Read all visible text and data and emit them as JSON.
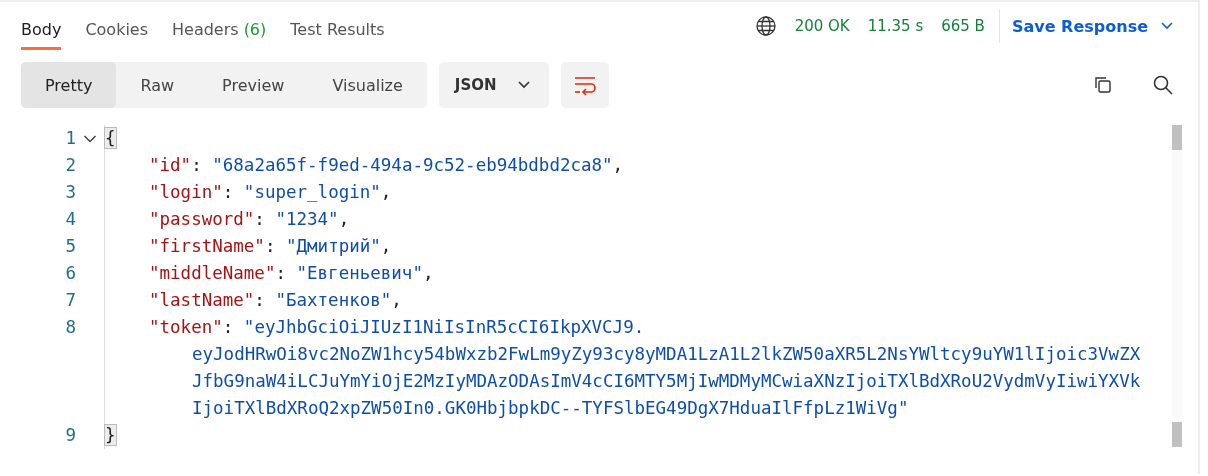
{
  "tabs": [
    {
      "label": "Body",
      "selected": true
    },
    {
      "label": "Cookies",
      "selected": false
    },
    {
      "label": "Headers",
      "count": "(6)",
      "selected": false
    },
    {
      "label": "Test Results",
      "selected": false
    }
  ],
  "status": {
    "code": "200 OK",
    "time": "11.35 s",
    "size": "665 B"
  },
  "save_response": "Save Response",
  "views": [
    {
      "label": "Pretty",
      "selected": true
    },
    {
      "label": "Raw",
      "selected": false
    },
    {
      "label": "Preview",
      "selected": false
    },
    {
      "label": "Visualize",
      "selected": false
    }
  ],
  "format": "JSON",
  "wrap_lines": {
    "on": true
  },
  "lines": [
    {
      "number": "1",
      "kind": "brace",
      "fold": true,
      "tokens": [
        {
          "t": "{",
          "kind": "brace",
          "highlighted": true
        }
      ]
    },
    {
      "number": "2",
      "kind": "member",
      "tokens": [
        {
          "t": "\"id\"",
          "kind": "key"
        },
        {
          "t": ": ",
          "kind": "punct"
        },
        {
          "t": "\"68a2a65f-f9ed-494a-9c52-eb94bdbd2ca8\"",
          "kind": "string"
        },
        {
          "t": ",",
          "kind": "punct"
        }
      ]
    },
    {
      "number": "3",
      "kind": "member",
      "tokens": [
        {
          "t": "\"login\"",
          "kind": "key"
        },
        {
          "t": ": ",
          "kind": "punct"
        },
        {
          "t": "\"super_login\"",
          "kind": "string"
        },
        {
          "t": ",",
          "kind": "punct"
        }
      ]
    },
    {
      "number": "4",
      "kind": "member",
      "tokens": [
        {
          "t": "\"password\"",
          "kind": "key"
        },
        {
          "t": ": ",
          "kind": "punct"
        },
        {
          "t": "\"1234\"",
          "kind": "string"
        },
        {
          "t": ",",
          "kind": "punct"
        }
      ]
    },
    {
      "number": "5",
      "kind": "member",
      "tokens": [
        {
          "t": "\"firstName\"",
          "kind": "key"
        },
        {
          "t": ": ",
          "kind": "punct"
        },
        {
          "t": "\"Дмитрий\"",
          "kind": "string"
        },
        {
          "t": ",",
          "kind": "punct"
        }
      ]
    },
    {
      "number": "6",
      "kind": "member",
      "tokens": [
        {
          "t": "\"middleName\"",
          "kind": "key"
        },
        {
          "t": ": ",
          "kind": "punct"
        },
        {
          "t": "\"Евгеньевич\"",
          "kind": "string"
        },
        {
          "t": ",",
          "kind": "punct"
        }
      ]
    },
    {
      "number": "7",
      "kind": "member",
      "tokens": [
        {
          "t": "\"lastName\"",
          "kind": "key"
        },
        {
          "t": ": ",
          "kind": "punct"
        },
        {
          "t": "\"Бахтенков\"",
          "kind": "string"
        },
        {
          "t": ",",
          "kind": "punct"
        }
      ]
    },
    {
      "number": "8",
      "kind": "member",
      "tokens": [
        {
          "t": "\"token\"",
          "kind": "key"
        },
        {
          "t": ": ",
          "kind": "punct"
        },
        {
          "t": "\"eyJhbGciOiJIUzI1NiIsInR5cCI6IkpXVCJ9.",
          "kind": "string"
        }
      ],
      "wrapped": [
        "eyJodHRwOi8vc2NoZW1hcy54bWxzb2FwLm9yZy93cy8yMDA1LzA1L2lkZW50aXR5L2NsYWltcy9uYW1lIjoic3VwZX",
        "JfbG9naW4iLCJuYmYiOjE2MzIyMDAzODAsImV4cCI6MTY5MjIwMDMyMCwiaXNzIjoiTXlBdXRoU2VydmVyIiwiYXVk",
        "IjoiTXlBdXRoQ2xpZW50In0.GK0HbjbpkDC--TYFSlbEG49DgX7HduaIlFfpLz1WiVg\""
      ]
    },
    {
      "number": "9",
      "kind": "brace",
      "fold": false,
      "tokens": [
        {
          "t": "}",
          "kind": "brace",
          "highlighted": true
        }
      ]
    }
  ]
}
